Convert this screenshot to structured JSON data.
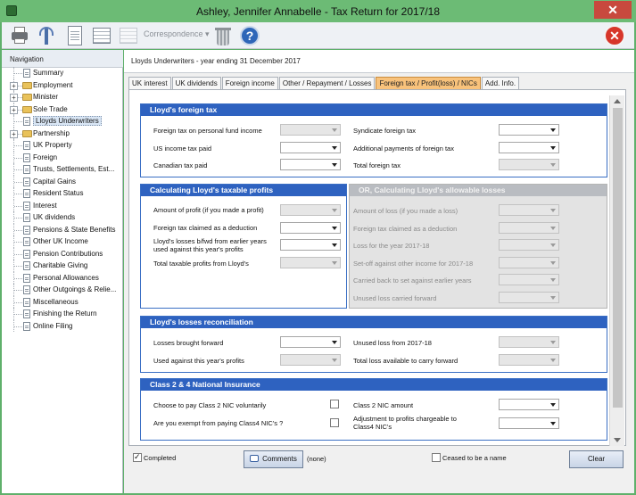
{
  "window": {
    "title": "Ashley, Jennifer Annabelle - Tax Return for 2017/18",
    "close_glyph": "✕"
  },
  "toolbar": {
    "correspondence_label": "Correspondence ▾",
    "help_glyph": "?",
    "exit_glyph": "✕"
  },
  "nav": {
    "header": "Navigation",
    "items": [
      {
        "label": "Summary",
        "icon": "page-icon",
        "expander": ""
      },
      {
        "label": "Employment",
        "icon": "folder-icon",
        "expander": "+"
      },
      {
        "label": "Minister",
        "icon": "folder-icon",
        "expander": "+"
      },
      {
        "label": "Sole Trade",
        "icon": "folder-icon",
        "expander": "+"
      },
      {
        "label": "Lloyds Underwriters",
        "icon": "page-icon",
        "expander": "",
        "selected": true
      },
      {
        "label": "Partnership",
        "icon": "folder-icon",
        "expander": "+"
      },
      {
        "label": "UK Property",
        "icon": "page-icon",
        "expander": ""
      },
      {
        "label": "Foreign",
        "icon": "page-icon",
        "expander": ""
      },
      {
        "label": "Trusts, Settlements, Est...",
        "icon": "page-icon",
        "expander": ""
      },
      {
        "label": "Capital Gains",
        "icon": "page-icon",
        "expander": ""
      },
      {
        "label": "Resident Status",
        "icon": "page-icon",
        "expander": ""
      },
      {
        "label": "Interest",
        "icon": "page-icon",
        "expander": ""
      },
      {
        "label": "UK dividends",
        "icon": "page-icon",
        "expander": ""
      },
      {
        "label": "Pensions & State Benefits",
        "icon": "page-icon",
        "expander": ""
      },
      {
        "label": "Other UK Income",
        "icon": "page-icon",
        "expander": ""
      },
      {
        "label": "Pension Contributions",
        "icon": "page-icon",
        "expander": ""
      },
      {
        "label": "Charitable Giving",
        "icon": "page-icon",
        "expander": ""
      },
      {
        "label": "Personal Allowances",
        "icon": "page-icon",
        "expander": ""
      },
      {
        "label": "Other Outgoings & Relie...",
        "icon": "page-icon",
        "expander": ""
      },
      {
        "label": "Miscellaneous",
        "icon": "page-icon",
        "expander": ""
      },
      {
        "label": "Finishing the Return",
        "icon": "page-icon",
        "expander": ""
      },
      {
        "label": "Online Filing",
        "icon": "page-icon",
        "expander": ""
      }
    ]
  },
  "main": {
    "header": "Lloyds Underwriters - year ending 31 December 2017",
    "tabs": [
      {
        "label": "UK interest"
      },
      {
        "label": "UK dividends"
      },
      {
        "label": "Foreign income"
      },
      {
        "label": "Other / Repayment / Losses"
      },
      {
        "label": "Foreign tax / Profit(loss) / NICs",
        "active": true
      },
      {
        "label": "Add. Info."
      }
    ]
  },
  "foreign_tax": {
    "title": "Lloyd's foreign tax",
    "left": [
      {
        "label": "Foreign tax on personal fund income",
        "disabled": true
      },
      {
        "label": "US income tax paid",
        "disabled": false
      },
      {
        "label": "Canadian tax paid",
        "disabled": false
      }
    ],
    "right": [
      {
        "label": "Syndicate foreign tax",
        "disabled": false
      },
      {
        "label": "Additional payments of foreign tax",
        "disabled": false
      },
      {
        "label": "Total foreign tax",
        "disabled": true
      }
    ]
  },
  "taxable_profits": {
    "title": "Calculating Lloyd's taxable profits",
    "rows": [
      {
        "label": "Amount of profit (if you made a profit)",
        "disabled": true
      },
      {
        "label": "Foreign tax claimed as a deduction",
        "disabled": false
      },
      {
        "label": "Lloyd's losses b/fwd from earlier years used against this year's profits",
        "disabled": false
      },
      {
        "label": "Total taxable profits from Lloyd's",
        "disabled": true
      }
    ]
  },
  "allowable_losses": {
    "title": "OR, Calculating Lloyd's allowable losses",
    "rows": [
      {
        "label": "Amount of loss (if you made a loss)"
      },
      {
        "label": "Foreign tax claimed as a deduction"
      },
      {
        "label": "Loss for the year 2017-18"
      },
      {
        "label": "Set-off against other income for 2017-18"
      },
      {
        "label": "Carried back to set against earlier years"
      },
      {
        "label": "Unused loss carried forward"
      }
    ]
  },
  "losses_reconciliation": {
    "title": "Lloyd's losses reconciliation",
    "left": [
      {
        "label": "Losses brought forward",
        "disabled": false
      },
      {
        "label": "Used against this year's profits",
        "disabled": true
      }
    ],
    "right": [
      {
        "label": "Unused loss from 2017-18",
        "disabled": true
      },
      {
        "label": "Total loss available to carry forward",
        "disabled": true
      }
    ]
  },
  "nic": {
    "title": "Class 2 & 4 National Insurance",
    "left": [
      {
        "label": "Choose to pay Class 2 NIC voluntarily",
        "checked": false
      },
      {
        "label": "Are you exempt from paying Class4 NIC's ?",
        "checked": false
      }
    ],
    "right": [
      {
        "label": "Class 2 NIC amount",
        "disabled": false
      },
      {
        "label": "Adjustment to profits chargeable to Class4 NIC's",
        "disabled": false
      }
    ]
  },
  "footer": {
    "completed_label": "Completed",
    "completed_checked": true,
    "comments_label": "Comments",
    "comments_value": "(none)",
    "ceased_label": "Ceased to be a name",
    "ceased_checked": false,
    "clear_label": "Clear"
  }
}
